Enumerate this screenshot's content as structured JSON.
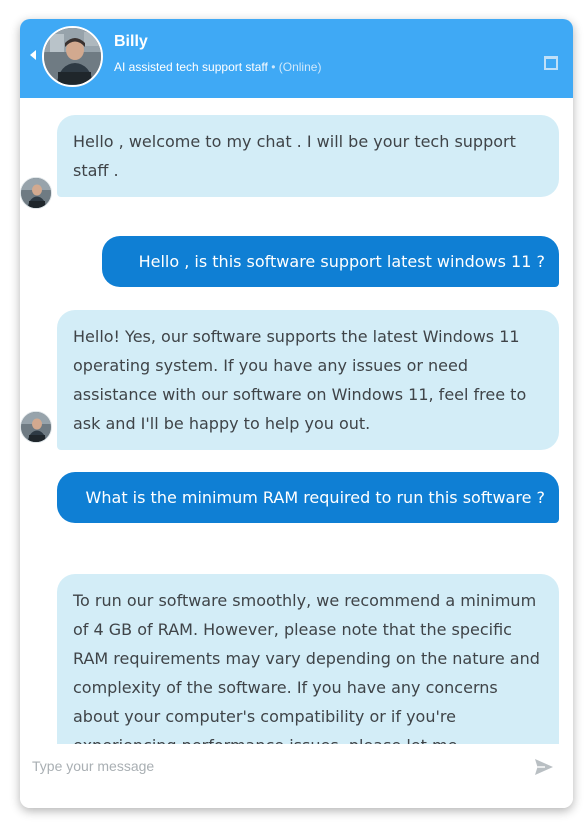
{
  "header": {
    "agent_name": "Billy",
    "agent_role": "AI assisted tech support staff",
    "separator": "•",
    "status": "(Online)"
  },
  "messages": [
    {
      "sender": "bot",
      "text": "Hello , welcome to my chat . I will be your tech support staff ."
    },
    {
      "sender": "user",
      "text": "Hello , is this software support latest windows 11 ?"
    },
    {
      "sender": "bot",
      "text": "Hello! Yes, our software supports the latest Windows 11 operating system. If you have any issues or need assistance with our software on Windows 11, feel free to ask and I'll be happy to help you out."
    },
    {
      "sender": "user",
      "text": "What is the minimum RAM required to run this software ?"
    },
    {
      "sender": "bot",
      "text": "To run our software smoothly, we recommend a minimum of 4 GB of RAM. However, please note that the specific RAM requirements may vary depending on the nature and complexity of the software. If you have any concerns about your computer's compatibility or if you're experiencing performance issues, please let me"
    }
  ],
  "input": {
    "placeholder": "Type your message",
    "value": ""
  },
  "icons": {
    "back": "chevron-left-icon",
    "window": "window-icon",
    "send": "send-icon"
  },
  "colors": {
    "header_bg": "#3fa9f5",
    "bot_bubble": "#d3edf7",
    "user_bubble": "#0f7fd4"
  }
}
